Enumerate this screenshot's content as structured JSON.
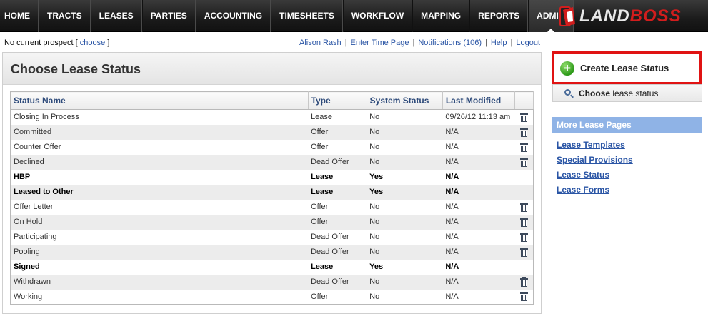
{
  "nav": {
    "items": [
      "HOME",
      "TRACTS",
      "LEASES",
      "PARTIES",
      "ACCOUNTING",
      "TIMESHEETS",
      "WORKFLOW",
      "MAPPING",
      "REPORTS",
      "ADMIN"
    ],
    "active": "ADMIN",
    "logo_part1": "LAND",
    "logo_part2": "BOSS"
  },
  "prospect": {
    "prefix": "No current prospect [",
    "link": "choose",
    "suffix": "]"
  },
  "userlinks": [
    "Alison Rash",
    "Enter Time Page",
    "Notifications (106)",
    "Help",
    "Logout"
  ],
  "panel": {
    "title": "Choose Lease Status",
    "columns": [
      "Status Name",
      "Type",
      "System Status",
      "Last Modified",
      ""
    ],
    "rows": [
      {
        "name": "Closing In Process",
        "type": "Lease",
        "system": "No",
        "modified": "09/26/12 11:13 am",
        "deletable": true,
        "bold": false
      },
      {
        "name": "Committed",
        "type": "Offer",
        "system": "No",
        "modified": "N/A",
        "deletable": true,
        "bold": false
      },
      {
        "name": "Counter Offer",
        "type": "Offer",
        "system": "No",
        "modified": "N/A",
        "deletable": true,
        "bold": false
      },
      {
        "name": "Declined",
        "type": "Dead Offer",
        "system": "No",
        "modified": "N/A",
        "deletable": true,
        "bold": false
      },
      {
        "name": "HBP",
        "type": "Lease",
        "system": "Yes",
        "modified": "N/A",
        "deletable": false,
        "bold": true
      },
      {
        "name": "Leased to Other",
        "type": "Lease",
        "system": "Yes",
        "modified": "N/A",
        "deletable": false,
        "bold": true
      },
      {
        "name": "Offer Letter",
        "type": "Offer",
        "system": "No",
        "modified": "N/A",
        "deletable": true,
        "bold": false
      },
      {
        "name": "On Hold",
        "type": "Offer",
        "system": "No",
        "modified": "N/A",
        "deletable": true,
        "bold": false
      },
      {
        "name": "Participating",
        "type": "Dead Offer",
        "system": "No",
        "modified": "N/A",
        "deletable": true,
        "bold": false
      },
      {
        "name": "Pooling",
        "type": "Dead Offer",
        "system": "No",
        "modified": "N/A",
        "deletable": true,
        "bold": false
      },
      {
        "name": "Signed",
        "type": "Lease",
        "system": "Yes",
        "modified": "N/A",
        "deletable": false,
        "bold": true
      },
      {
        "name": "Withdrawn",
        "type": "Dead Offer",
        "system": "No",
        "modified": "N/A",
        "deletable": true,
        "bold": false
      },
      {
        "name": "Working",
        "type": "Offer",
        "system": "No",
        "modified": "N/A",
        "deletable": true,
        "bold": false
      }
    ]
  },
  "side": {
    "create_label": "Create Lease Status",
    "choose_bold": "Choose",
    "choose_rest": " lease status",
    "more_header": "More Lease Pages",
    "more_links": [
      "Lease Templates",
      "Special Provisions",
      "Lease Status",
      "Lease Forms"
    ]
  },
  "colors": {
    "highlight_border": "#e01313",
    "link": "#2a55a5",
    "more_header_bg": "#8fb3e6",
    "logo_accent": "#d21d1d"
  }
}
